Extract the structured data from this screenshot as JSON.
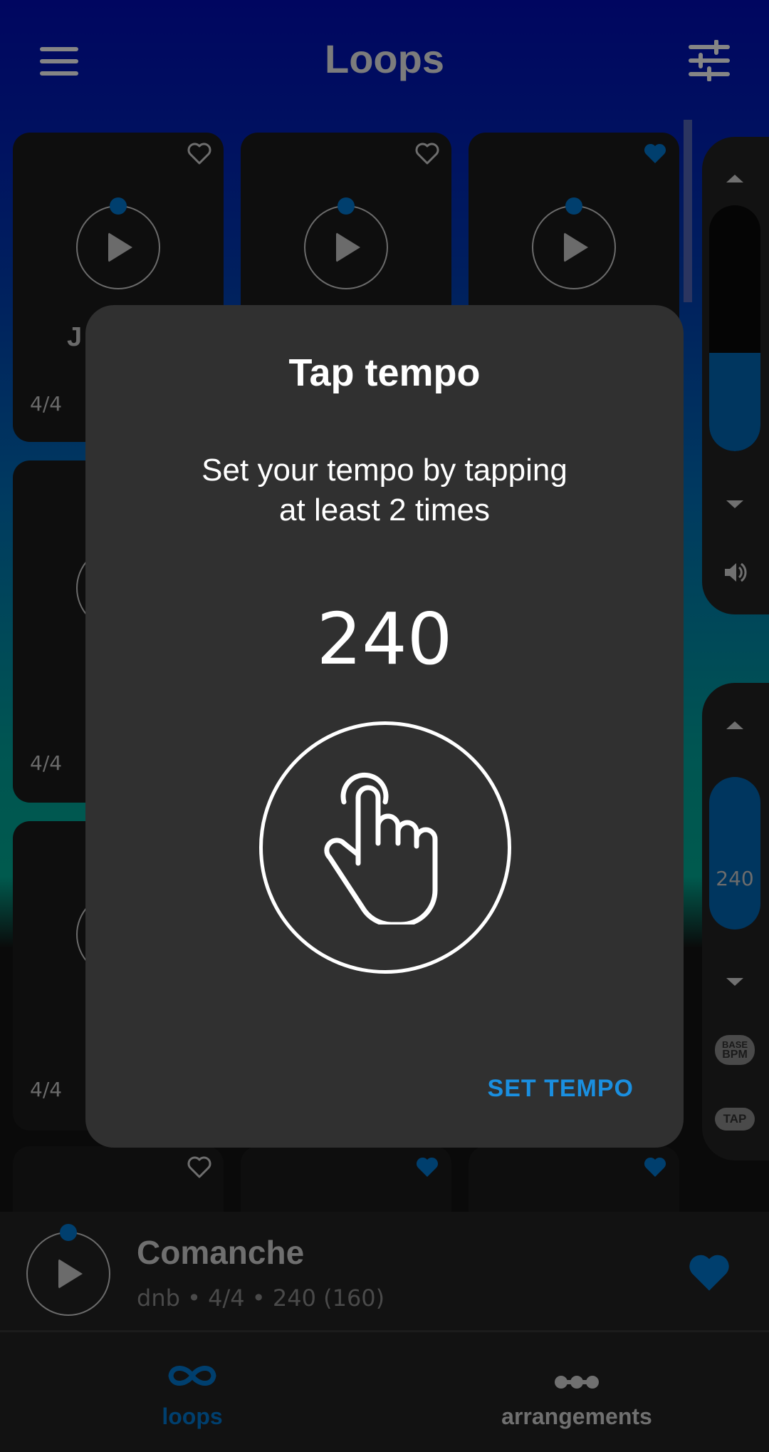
{
  "header": {
    "title": "Loops",
    "menu_icon": "hamburger-menu-icon",
    "filter_icon": "sliders-filter-icon"
  },
  "colors": {
    "accent": "#1a8fe0",
    "accent_dim": "#003f6e",
    "dialog_bg": "#303030",
    "card_bg": "#0e0e0e",
    "muted_text": "#6a6a6a"
  },
  "grid": {
    "cards": [
      {
        "title_partial": "J",
        "meter": "4/4",
        "favorite": false
      },
      {
        "title_partial": "",
        "meter": "",
        "favorite": false
      },
      {
        "title_partial": "",
        "meter": "",
        "favorite": true
      },
      {
        "title_partial": "",
        "meter": "4/4",
        "favorite": null
      },
      {
        "title_partial": "",
        "meter": "4/4",
        "favorite": null
      },
      {
        "title_partial": "",
        "meter": "",
        "favorite": false
      },
      {
        "title_partial": "",
        "meter": "",
        "favorite": true
      },
      {
        "title_partial": "",
        "meter": "",
        "favorite": true
      }
    ]
  },
  "volume_panel": {
    "up_icon": "triangle-up-icon",
    "down_icon": "triangle-down-icon",
    "speaker_icon": "volume-icon",
    "level_fraction": 0.4
  },
  "tempo_panel": {
    "up_icon": "triangle-up-icon",
    "down_icon": "triangle-down-icon",
    "bpm": "240",
    "base_bpm_line1": "BASE",
    "base_bpm_line2": "BPM",
    "tap_label": "TAP"
  },
  "dialog": {
    "title": "Tap tempo",
    "message": "Set your tempo by tapping\nat least 2 times",
    "bpm": "240",
    "tap_icon": "tap-hand-icon",
    "action_label": "SET TEMPO"
  },
  "now_playing": {
    "title": "Comanche",
    "subtitle": "dnb • 4/4 • 240 (160)",
    "favorite": true
  },
  "bottom_nav": {
    "items": [
      {
        "label": "loops",
        "icon": "infinity-loop-icon",
        "active": true
      },
      {
        "label": "arrangements",
        "icon": "arrangement-dots-icon",
        "active": false
      }
    ]
  }
}
